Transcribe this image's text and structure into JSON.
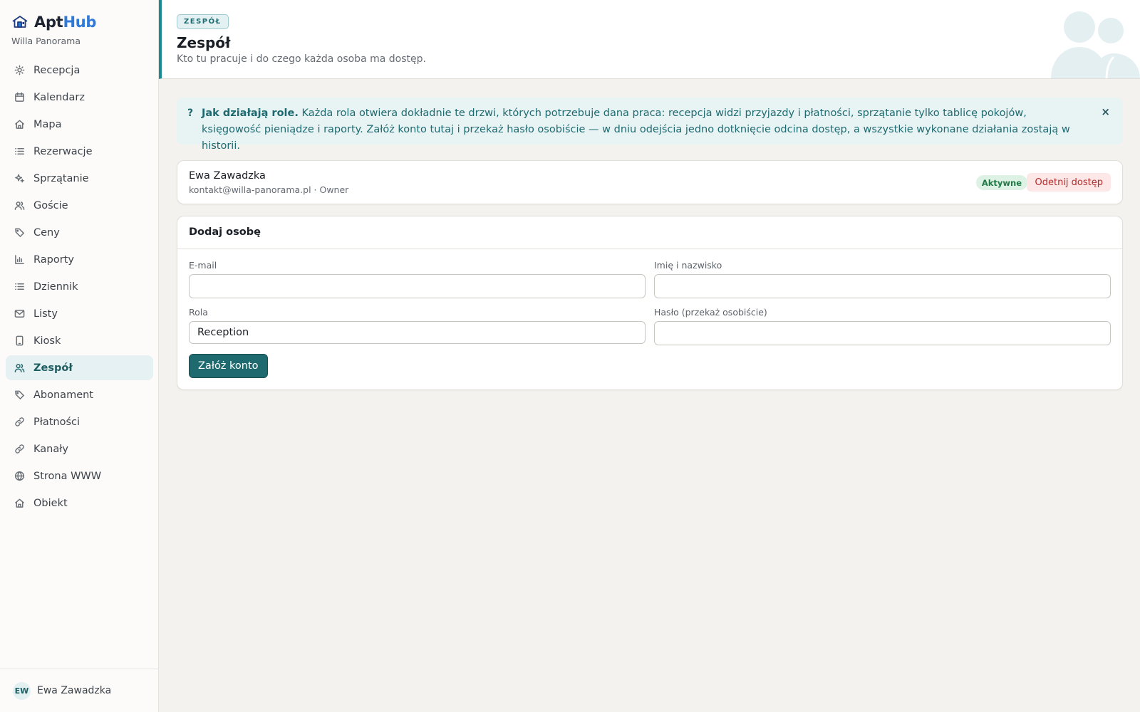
{
  "app": {
    "name_part1": "Apt",
    "name_part2": "Hub",
    "property": "Willa Panorama"
  },
  "nav": {
    "items": [
      {
        "label": "Recepcja",
        "icon": "sun-icon"
      },
      {
        "label": "Kalendarz",
        "icon": "calendar-icon"
      },
      {
        "label": "Mapa",
        "icon": "home-icon"
      },
      {
        "label": "Rezerwacje",
        "icon": "list-icon"
      },
      {
        "label": "Sprzątanie",
        "icon": "sparkle-icon"
      },
      {
        "label": "Goście",
        "icon": "users-icon"
      },
      {
        "label": "Ceny",
        "icon": "tag-icon"
      },
      {
        "label": "Raporty",
        "icon": "bar-chart-icon"
      },
      {
        "label": "Dziennik",
        "icon": "list-icon"
      },
      {
        "label": "Listy",
        "icon": "mail-icon"
      },
      {
        "label": "Kiosk",
        "icon": "tablet-icon"
      },
      {
        "label": "Zespół",
        "icon": "users-icon",
        "active": true
      },
      {
        "label": "Abonament",
        "icon": "tag-icon"
      },
      {
        "label": "Płatności",
        "icon": "link-icon"
      },
      {
        "label": "Kanały",
        "icon": "link-icon"
      },
      {
        "label": "Strona WWW",
        "icon": "globe-icon"
      },
      {
        "label": "Obiekt",
        "icon": "home-icon"
      }
    ]
  },
  "user": {
    "initials": "EW",
    "name": "Ewa Zawadzka"
  },
  "header": {
    "eyebrow": "ZESPÓŁ",
    "title": "Zespół",
    "subtitle": "Kto tu pracuje i do czego każda osoba ma dostęp."
  },
  "info": {
    "lead": "Jak działają role.",
    "text": " Każda rola otwiera dokładnie te drzwi, których potrzebuje dana praca: recepcja widzi przyjazdy i płatności, sprzątanie tylko tablicę pokojów, księgowość pieniądze i raporty. Załóż konto tutaj i przekaż hasło osobiście — w dniu odejścia jedno dotknięcie odcina dostęp, a wszystkie wykonane działania zostają w historii.",
    "help_glyph": "?",
    "close_glyph": "×"
  },
  "members": [
    {
      "name": "Ewa Zawadzka",
      "meta": "kontakt@willa-panorama.pl · Owner",
      "status": "Aktywne",
      "action": "Odetnij dostęp"
    }
  ],
  "form": {
    "title": "Dodaj osobę",
    "email_label": "E-mail",
    "email_value": "",
    "name_label": "Imię i nazwisko",
    "name_value": "",
    "role_label": "Rola",
    "role_value": "Reception",
    "password_label": "Hasło (przekaż osobiście)",
    "password_value": "",
    "submit": "Załóż konto"
  },
  "colors": {
    "accent": "#1e6a70",
    "brand_blue": "#2f7ad8",
    "active_status": "#1f7a45",
    "danger": "#b42d2d"
  }
}
